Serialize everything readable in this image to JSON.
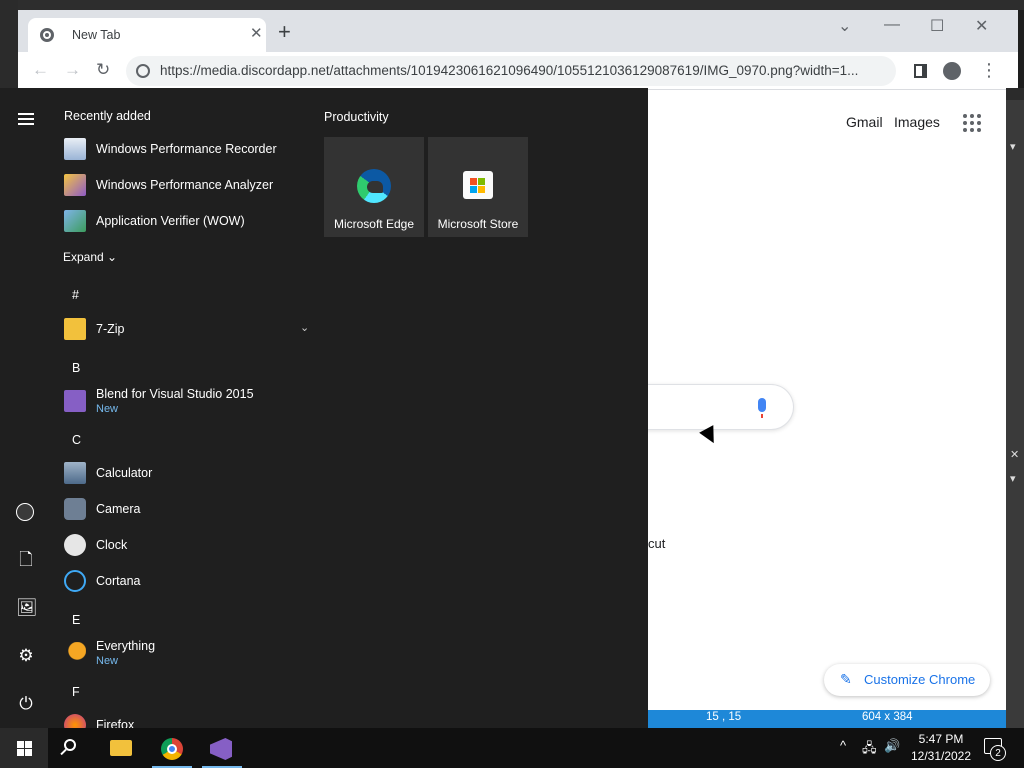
{
  "browser": {
    "tab_title": "New Tab",
    "url": "https://media.discordapp.net/attachments/1019423061621096490/1055121036129087619/IMG_0970.png?width=1...",
    "header_links": [
      "Gmail",
      "Images"
    ],
    "shortcut_partial_text": "cut",
    "customize_label": "Customize Chrome"
  },
  "status_bar": {
    "coordinates": "15 , 15",
    "dimensions": "604 x 384"
  },
  "start_menu": {
    "recently_added_title": "Recently added",
    "recently_added": [
      {
        "name": "Windows Performance Recorder",
        "icon": "performance-recorder-icon"
      },
      {
        "name": "Windows Performance Analyzer",
        "icon": "performance-analyzer-icon"
      },
      {
        "name": "Application Verifier (WOW)",
        "icon": "app-verifier-icon"
      }
    ],
    "expand_label": "Expand",
    "letters": [
      "#",
      "B",
      "C",
      "E",
      "F"
    ],
    "apps": {
      "seven_zip": {
        "name": "7-Zip"
      },
      "blend": {
        "name": "Blend for Visual Studio 2015",
        "badge": "New"
      },
      "calculator": {
        "name": "Calculator"
      },
      "camera": {
        "name": "Camera"
      },
      "clock": {
        "name": "Clock"
      },
      "cortana": {
        "name": "Cortana"
      },
      "everything": {
        "name": "Everything",
        "badge": "New"
      },
      "firefox": {
        "name": "Firefox"
      }
    },
    "tile_group_title": "Productivity",
    "tiles": [
      {
        "label": "Microsoft Edge",
        "icon": "edge-icon"
      },
      {
        "label": "Microsoft Store",
        "icon": "store-icon"
      }
    ]
  },
  "taskbar": {
    "clock_time": "5:47 PM",
    "clock_date": "12/31/2022",
    "notification_count": "2",
    "pinned": [
      "file-explorer-icon",
      "chrome-icon",
      "visual-studio-icon"
    ]
  },
  "colors": {
    "start_bg": "#1f1f1f",
    "taskbar_bg": "#101010",
    "accent_blue": "#1a73e8",
    "new_badge": "#76b9ed"
  }
}
